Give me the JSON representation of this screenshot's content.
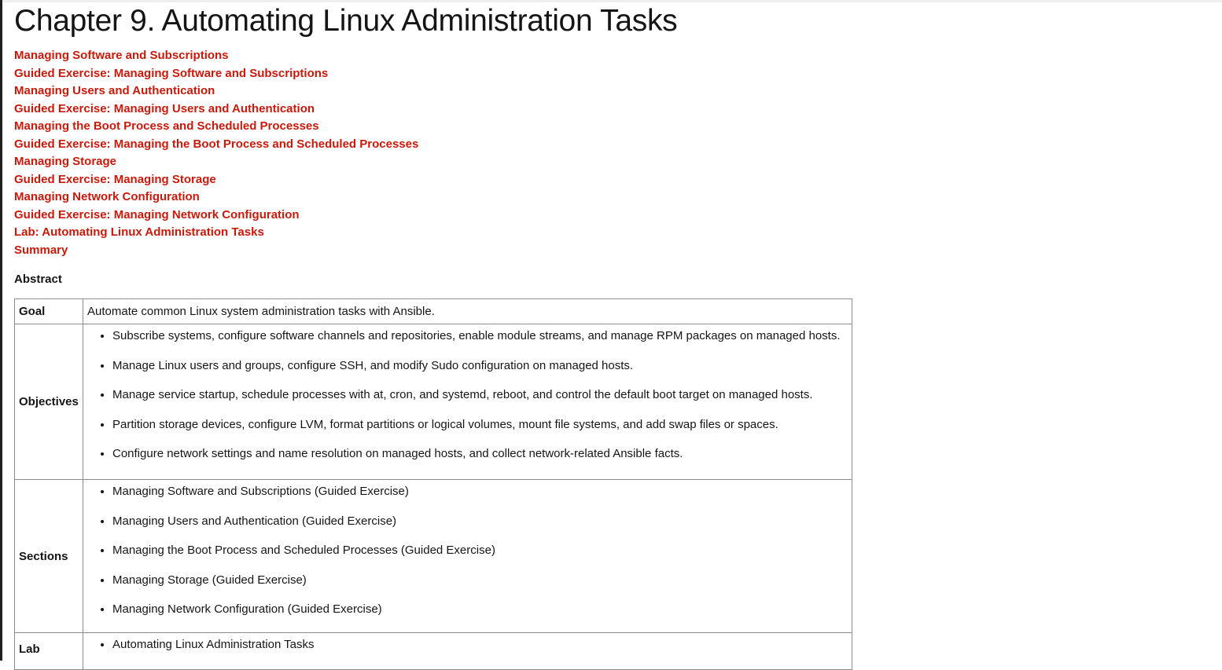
{
  "chapter_title": "Chapter 9. Automating Linux Administration Tasks",
  "toc_links": [
    "Managing Software and Subscriptions",
    "Guided Exercise: Managing Software and Subscriptions",
    "Managing Users and Authentication",
    "Guided Exercise: Managing Users and Authentication",
    "Managing the Boot Process and Scheduled Processes",
    "Guided Exercise: Managing the Boot Process and Scheduled Processes",
    "Managing Storage",
    "Guided Exercise: Managing Storage",
    "Managing Network Configuration",
    "Guided Exercise: Managing Network Configuration",
    "Lab: Automating Linux Administration Tasks",
    "Summary"
  ],
  "abstract_label": "Abstract",
  "table": {
    "goal_label": "Goal",
    "goal_text": "Automate common Linux system administration tasks with Ansible.",
    "objectives_label": "Objectives",
    "objectives": [
      "Subscribe systems, configure software channels and repositories, enable module streams, and manage RPM packages on managed hosts.",
      "Manage Linux users and groups, configure SSH, and modify Sudo configuration on managed hosts.",
      "Manage service startup, schedule processes with at, cron, and systemd, reboot, and control the default boot target on managed hosts.",
      "Partition storage devices, configure LVM, format partitions or logical volumes, mount file systems, and add swap files or spaces.",
      "Configure network settings and name resolution on managed hosts, and collect network-related Ansible facts."
    ],
    "sections_label": "Sections",
    "sections": [
      "Managing Software and Subscriptions (Guided Exercise)",
      "Managing Users and Authentication (Guided Exercise)",
      "Managing the Boot Process and Scheduled Processes (Guided Exercise)",
      "Managing Storage (Guided Exercise)",
      "Managing Network Configuration (Guided Exercise)"
    ],
    "lab_label": "Lab",
    "lab": [
      "Automating Linux Administration Tasks"
    ]
  },
  "colors": {
    "link": "#c9190b",
    "text": "#151515",
    "border": "#8a8d90"
  }
}
